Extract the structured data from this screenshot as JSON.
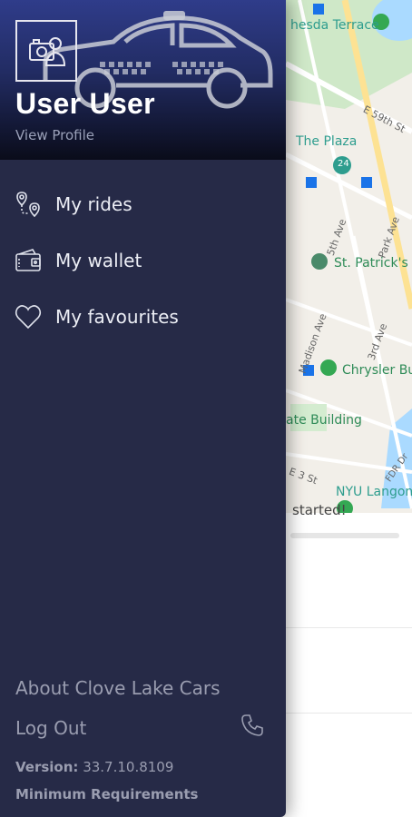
{
  "map": {
    "labels": {
      "terrace": "hesda Terrace",
      "street_e59": "E 59th St",
      "plaza": "The Plaza",
      "badge_24": "24",
      "ave_5th": "5th Ave",
      "ave_park": "Park Ave",
      "patricks": "St. Patrick's C",
      "ave_madison": "Madison Ave",
      "ave_3rd": "3rd Ave",
      "chrysler": "Chrysler Bu",
      "state_building": "ate Building",
      "fdr": "FDR Dr",
      "street_e": "E 3 St",
      "nyu": "NYU Langon"
    }
  },
  "sheet": {
    "partial_text": "started!"
  },
  "drawer": {
    "user_name": "User User",
    "view_profile": "View Profile",
    "menu": [
      {
        "label": "My rides",
        "icon": "route-pins-icon"
      },
      {
        "label": "My wallet",
        "icon": "wallet-icon"
      },
      {
        "label": "My favourites",
        "icon": "heart-icon"
      }
    ],
    "about": "About Clove Lake Cars",
    "logout": "Log Out",
    "version_label": "Version:",
    "version_value": "33.7.10.8109",
    "min_requirements": "Minimum Requirements"
  },
  "colors": {
    "drawer_bg": "#262a47",
    "header_top": "#2f3c8a",
    "text_muted": "#9a9db0",
    "map_green": "#2e8b57"
  }
}
